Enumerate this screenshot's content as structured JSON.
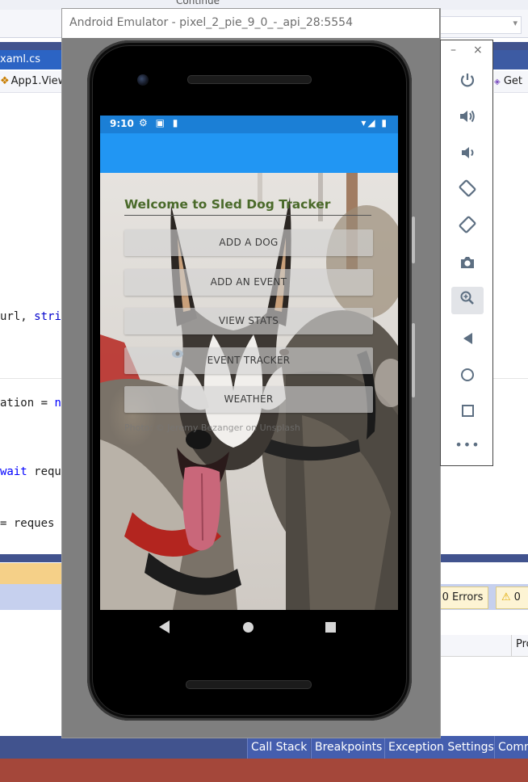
{
  "vs": {
    "top_partial_text": "Continue",
    "tab_active_label": "xaml.cs",
    "nav_left_label": "App1.View",
    "nav_right_label": "Get",
    "code_lines": [
      {
        "prefix": "url, ",
        "kw": "stri",
        "suffix": ""
      },
      {
        "prefix": "ation = ",
        "kw": "n",
        "suffix": ""
      },
      {
        "prefix": "",
        "kw": "wait",
        "suffix": " requ"
      },
      {
        "prefix": " = reques",
        "kw": "",
        "suffix": ""
      }
    ],
    "errors_label": "0 Errors",
    "warnings_count": "0",
    "grid_header_label": "Pro",
    "bottom_tabs": [
      "Call Stack",
      "Breakpoints",
      "Exception Settings",
      "Comm"
    ]
  },
  "emulator": {
    "window_title": "Android Emulator - pixel_2_pie_9_0_-_api_28:5554",
    "status_time": "9:10",
    "status_icons_left": "⚙ ▣ ▮",
    "status_icons_right": "▾◢ ▮"
  },
  "app": {
    "welcome_title": "Welcome to Sled Dog Tracker",
    "buttons": [
      "ADD A DOG",
      "ADD AN EVENT",
      "VIEW STATS",
      "EVENT TRACKER",
      "WEATHER"
    ],
    "photo_credit": "Photo: © Jeremy Bezanger on Unsplash"
  },
  "tools": {
    "minimize_glyph": "–",
    "close_glyph": "×",
    "icons": [
      "power-icon",
      "volume-up-icon",
      "volume-down-icon",
      "rotate-left-icon",
      "rotate-right-icon",
      "camera-icon",
      "zoom-icon",
      "back-icon",
      "home-icon",
      "overview-icon",
      "more-icon"
    ]
  }
}
